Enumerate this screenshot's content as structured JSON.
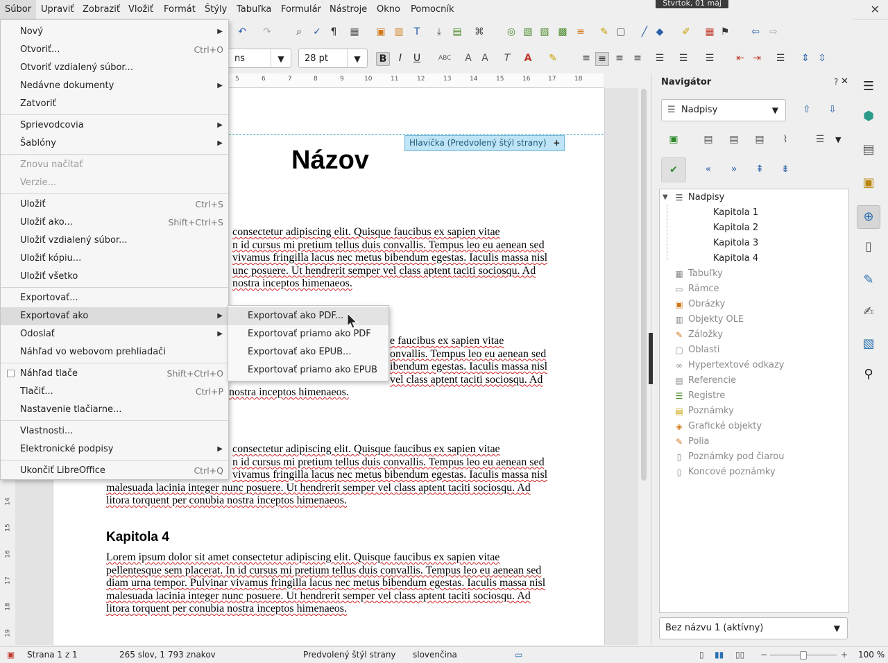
{
  "menubar": {
    "items": [
      "Súbor",
      "Upraviť",
      "Zobraziť",
      "Vložiť",
      "Formát",
      "Štýly",
      "Tabuľka",
      "Formulár",
      "Nástroje",
      "Okno",
      "Pomocník"
    ],
    "clock": "Štvrtok, 01 máj"
  },
  "toolbar": {
    "font_name_partial": "ns",
    "font_size": "28 pt"
  },
  "ruler": {
    "ticks": [
      "5",
      "6",
      "7",
      "8",
      "9",
      "10",
      "11",
      "12",
      "13",
      "14",
      "15",
      "16",
      "17",
      "18"
    ]
  },
  "vruler": {
    "ticks": [
      "14",
      "15",
      "16",
      "17",
      "18",
      "19"
    ]
  },
  "document": {
    "header_tag": "Hlavička (Predvolený štýl strany)",
    "header_tag_plus": "+",
    "title": "Názov",
    "para1_lines": [
      "consectetur adipiscing elit. Quisque faucibus ex sapien vitae",
      "n id cursus mi pretium tellus duis convallis. Tempus leo eu aenean sed",
      "vivamus fringilla lacus nec metus bibendum egestas. Iaculis massa nisl",
      "unc posuere. Ut hendrerit semper vel class aptent taciti sociosqu. Ad",
      "nostra inceptos himenaeos."
    ],
    "para2_lines": [
      "e faucibus ex sapien vitae",
      "onvallis. Tempus leo eu aenean sed",
      "ibendum egestas. Iaculis massa nisl",
      "vel class aptent taciti sociosqu. Ad",
      "nostra inceptos himenaeos."
    ],
    "para3_lines": [
      "consectetur adipiscing elit. Quisque faucibus ex sapien vitae",
      "n id cursus mi pretium tellus duis convallis. Tempus leo eu aenean sed",
      "vivamus fringilla lacus nec metus bibendum egestas. Iaculis massa nisl",
      "malesuada lacinia integer nunc posuere. Ut hendrerit semper vel class aptent taciti sociosqu. Ad",
      "litora torquent per conubia nostra inceptos himenaeos."
    ],
    "chapter4": "Kapitola 4",
    "para4_lines": [
      "Lorem ipsum dolor sit amet consectetur adipiscing elit. Quisque faucibus ex sapien vitae",
      "pellentesque sem placerat. In id cursus mi pretium tellus duis convallis. Tempus leo eu aenean sed",
      "diam urna tempor. Pulvinar vivamus fringilla lacus nec metus bibendum egestas. Iaculis massa nisl",
      "malesuada lacinia integer nunc posuere. Ut hendrerit semper vel class aptent taciti sociosqu. Ad",
      "litora torquent per conubia nostra inceptos himenaeos."
    ]
  },
  "file_menu": {
    "items": [
      {
        "label": "Nový",
        "shortcut": "",
        "submenu": true,
        "disabled": false
      },
      {
        "label": "Otvoriť...",
        "shortcut": "Ctrl+O",
        "submenu": false,
        "disabled": false
      },
      {
        "label": "Otvoriť vzdialený súbor...",
        "shortcut": "",
        "submenu": false,
        "disabled": false
      },
      {
        "label": "Nedávne dokumenty",
        "shortcut": "",
        "submenu": true,
        "disabled": false
      },
      {
        "label": "Zatvoriť",
        "shortcut": "",
        "submenu": false,
        "disabled": false
      },
      {
        "label": "Sprievodcovia",
        "shortcut": "",
        "submenu": true,
        "disabled": false
      },
      {
        "label": "Šablóny",
        "shortcut": "",
        "submenu": true,
        "disabled": false
      },
      {
        "label": "Znovu načítať",
        "shortcut": "",
        "submenu": false,
        "disabled": true
      },
      {
        "label": "Verzie...",
        "shortcut": "",
        "submenu": false,
        "disabled": true
      },
      {
        "label": "Uložiť",
        "shortcut": "Ctrl+S",
        "submenu": false,
        "disabled": false
      },
      {
        "label": "Uložiť ako...",
        "shortcut": "Shift+Ctrl+S",
        "submenu": false,
        "disabled": false
      },
      {
        "label": "Uložiť vzdialený súbor...",
        "shortcut": "",
        "submenu": false,
        "disabled": false
      },
      {
        "label": "Uložiť kópiu...",
        "shortcut": "",
        "submenu": false,
        "disabled": false
      },
      {
        "label": "Uložiť všetko",
        "shortcut": "",
        "submenu": false,
        "disabled": false
      },
      {
        "label": "Exportovať...",
        "shortcut": "",
        "submenu": false,
        "disabled": false
      },
      {
        "label": "Exportovať ako",
        "shortcut": "",
        "submenu": true,
        "disabled": false
      },
      {
        "label": "Odoslať",
        "shortcut": "",
        "submenu": true,
        "disabled": false
      },
      {
        "label": "Náhľad vo webovom prehliadači",
        "shortcut": "",
        "submenu": false,
        "disabled": false
      },
      {
        "label": "Náhľad tlače",
        "shortcut": "Shift+Ctrl+O",
        "submenu": false,
        "disabled": false
      },
      {
        "label": "Tlačiť...",
        "shortcut": "Ctrl+P",
        "submenu": false,
        "disabled": false
      },
      {
        "label": "Nastavenie tlačiarne...",
        "shortcut": "",
        "submenu": false,
        "disabled": false
      },
      {
        "label": "Vlastnosti...",
        "shortcut": "",
        "submenu": false,
        "disabled": false
      },
      {
        "label": "Elektronické podpisy",
        "shortcut": "",
        "submenu": true,
        "disabled": false
      },
      {
        "label": "Ukončiť LibreOffice",
        "shortcut": "Ctrl+Q",
        "submenu": false,
        "disabled": false
      }
    ]
  },
  "export_submenu": {
    "items": [
      "Exportovať ako PDF...",
      "Exportovať priamo ako PDF",
      "Exportovať ako EPUB...",
      "Exportovať priamo ako EPUB"
    ]
  },
  "navigator": {
    "title": "Navigátor",
    "help": "?",
    "close": "✕",
    "category_select": "Nadpisy",
    "tree": {
      "root": "Nadpisy",
      "headings": [
        "Kapitola 1",
        "Kapitola 2",
        "Kapitola 3",
        "Kapitola 4"
      ],
      "categories": [
        "Tabuľky",
        "Rámce",
        "Obrázky",
        "Objekty OLE",
        "Záložky",
        "Oblasti",
        "Hypertextové odkazy",
        "Referencie",
        "Registre",
        "Poznámky",
        "Grafické objekty",
        "Polia",
        "Poznámky pod čiarou",
        "Koncové poznámky"
      ]
    },
    "document_select": "Bez názvu 1 (aktívny)"
  },
  "statusbar": {
    "page": "Strana 1 z 1",
    "words": "265 slov, 1 793 znakov",
    "page_style": "Predvolený štýl strany",
    "language": "slovenčina",
    "zoom": "100 %"
  },
  "colors": {
    "accent": "#2a5ea8",
    "menu_highlight": "#dcdcdc",
    "spell_underline": "#d02020"
  }
}
